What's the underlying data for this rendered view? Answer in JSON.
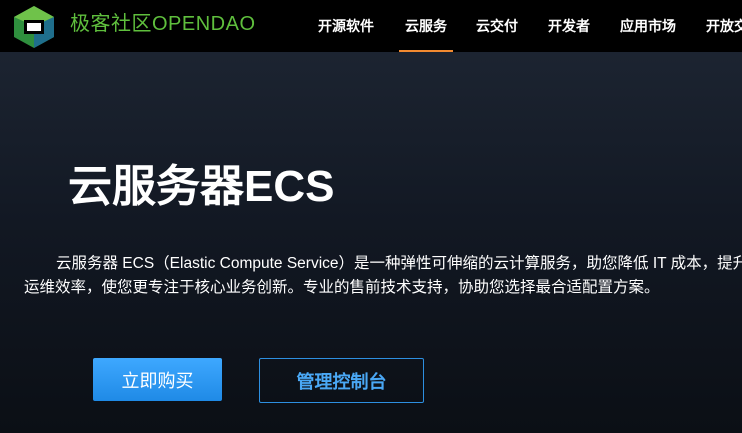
{
  "header": {
    "brand": "极客社区OPENDAO",
    "nav": [
      {
        "label": "开源软件"
      },
      {
        "label": "云服务"
      },
      {
        "label": "云交付"
      },
      {
        "label": "开发者"
      },
      {
        "label": "应用市场"
      },
      {
        "label": "开放交"
      }
    ],
    "active_index": 1
  },
  "hero": {
    "title": "云服务器ECS",
    "description": "云服务器 ECS（Elastic Compute Service）是一种弹性可伸缩的云计算服务，助您降低 IT 成本，提升运维效率，使您更专注于核心业务创新。专业的售前技术支持，协助您选择最合适配置方案。",
    "buy_button": "立即购买",
    "console_button": "管理控制台"
  },
  "colors": {
    "accent": "#f28a30",
    "brand_green": "#5fbf3d",
    "primary_blue": "#2d8fe0"
  },
  "icons": {
    "logo": "opendao-cube-logo"
  }
}
